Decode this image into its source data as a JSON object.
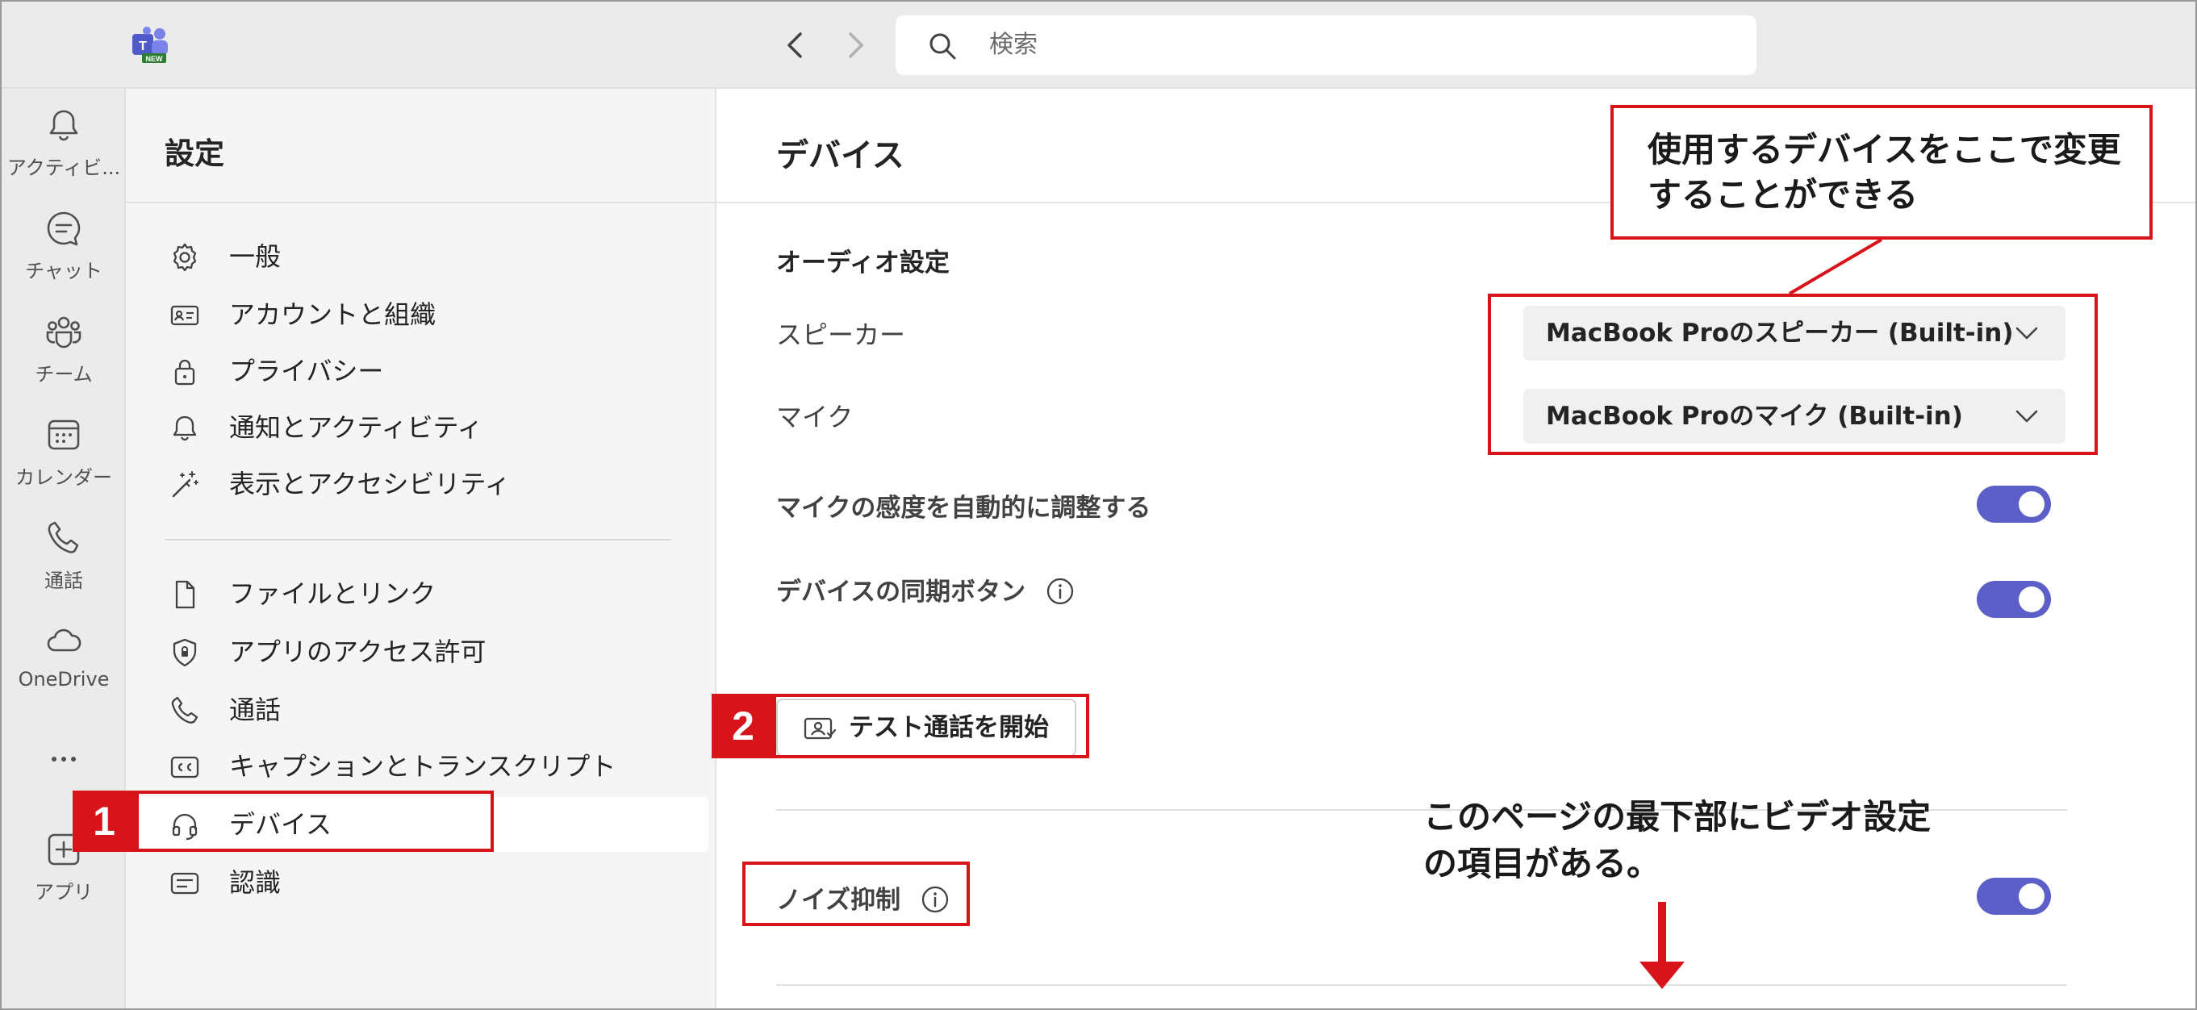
{
  "app": {
    "logo_badge": "NEW"
  },
  "search": {
    "placeholder": "検索"
  },
  "rail": {
    "items": [
      {
        "label": "アクティビ...",
        "icon": "bell-icon"
      },
      {
        "label": "チャット",
        "icon": "chat-icon"
      },
      {
        "label": "チーム",
        "icon": "teams-icon"
      },
      {
        "label": "カレンダー",
        "icon": "calendar-icon"
      },
      {
        "label": "通話",
        "icon": "phone-icon"
      },
      {
        "label": "OneDrive",
        "icon": "cloud-icon"
      },
      {
        "label": "",
        "icon": "more-icon"
      },
      {
        "label": "アプリ",
        "icon": "add-app-icon"
      }
    ]
  },
  "settings": {
    "title": "設定",
    "items": [
      {
        "label": "一般",
        "icon": "gear-icon"
      },
      {
        "label": "アカウントと組織",
        "icon": "id-card-icon"
      },
      {
        "label": "プライバシー",
        "icon": "lock-icon"
      },
      {
        "label": "通知とアクティビティ",
        "icon": "bell-icon"
      },
      {
        "label": "表示とアクセシビリティ",
        "icon": "magic-wand-icon"
      },
      {
        "label": "ファイルとリンク",
        "icon": "file-icon"
      },
      {
        "label": "アプリのアクセス許可",
        "icon": "shield-icon"
      },
      {
        "label": "通話",
        "icon": "phone-icon"
      },
      {
        "label": "キャプションとトランスクリプト",
        "icon": "cc-icon"
      },
      {
        "label": "デバイス",
        "icon": "headset-icon",
        "selected": true
      },
      {
        "label": "認識",
        "icon": "text-icon"
      }
    ]
  },
  "main": {
    "title": "デバイス",
    "audio_heading": "オーディオ設定",
    "speaker_label": "スピーカー",
    "speaker_value": "MacBook Proのスピーカー (Built-in)",
    "mic_label": "マイク",
    "mic_value": "MacBook Proのマイク (Built-in)",
    "auto_mic_label": "マイクの感度を自動的に調整する",
    "auto_mic_on": true,
    "sync_label": "デバイスの同期ボタン",
    "sync_on": true,
    "test_call_label": "テスト通話を開始",
    "noise_label": "ノイズ抑制",
    "noise_on": true
  },
  "annotations": {
    "callout": "使用するデバイスをここで変更することができる",
    "badge1": "1",
    "badge2": "2",
    "bottom_note": "このページの最下部にビデオ設定の項目がある。"
  },
  "colors": {
    "accent": "#5b5fc7",
    "annotation_red": "#d7141a",
    "rail_bg": "#ebebeb",
    "settings_bg": "#f5f5f5"
  }
}
